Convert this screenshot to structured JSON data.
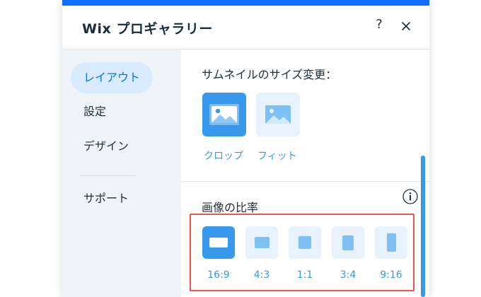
{
  "header": {
    "title": "Wix プロギャラリー",
    "help_label": "?"
  },
  "sidebar": {
    "items": [
      {
        "label": "レイアウト",
        "active": true
      },
      {
        "label": "設定",
        "active": false
      },
      {
        "label": "デザイン",
        "active": false
      },
      {
        "label": "サポート",
        "active": false
      }
    ]
  },
  "thumbnail_resize": {
    "label": "サムネイルのサイズ変更：",
    "options": [
      {
        "label": "クロップ",
        "icon": "image-crop-icon",
        "selected": true
      },
      {
        "label": "フィット",
        "icon": "image-fit-icon",
        "selected": false
      }
    ]
  },
  "image_ratio": {
    "label": "画像の比率",
    "info_icon": "info-icon",
    "options": [
      {
        "label": "16:9",
        "ratio": 1.778,
        "selected": true
      },
      {
        "label": "4:3",
        "ratio": 1.333,
        "selected": false
      },
      {
        "label": "1:1",
        "ratio": 1.0,
        "selected": false
      },
      {
        "label": "3:4",
        "ratio": 0.75,
        "selected": false
      },
      {
        "label": "9:16",
        "ratio": 0.5625,
        "selected": false
      }
    ]
  },
  "colors": {
    "accent": "#116dff",
    "selected": "#3899ec",
    "highlight_border": "#e8564d"
  }
}
